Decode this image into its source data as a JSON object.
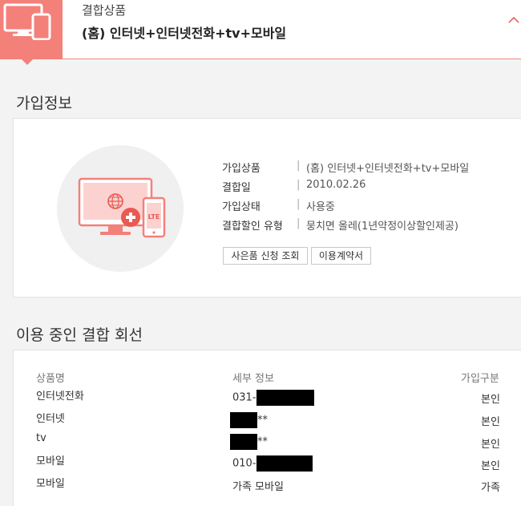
{
  "header": {
    "subtitle": "결합상품",
    "title": "(홈) 인터넷+인터넷전화+tv+모바일"
  },
  "signup_info": {
    "section_title": "가입정보",
    "rows": [
      {
        "label": "가입상품",
        "value": "(홈) 인터넷+인터넷전화+tv+모바일"
      },
      {
        "label": "결합일",
        "value": "2010.02.26"
      },
      {
        "label": "가입상태",
        "value": "사용중"
      },
      {
        "label": "결합할인 유형",
        "value": "뭉치면 올레(1년약정이상할인제공)"
      }
    ],
    "separator": "|",
    "icon_badge": "LTE",
    "buttons": {
      "gift_inquiry": "사은품 신청 조회",
      "contract": "이용계약서"
    }
  },
  "lines": {
    "section_title": "이용 중인 결합 회선",
    "columns": {
      "product": "상품명",
      "detail": "세부 정보",
      "type": "가입구분"
    },
    "rows": [
      {
        "product": "인터넷전화",
        "detail_prefix": "031-",
        "detail_suffix": "",
        "type": "본인"
      },
      {
        "product": "인터넷",
        "detail_prefix": "",
        "detail_suffix": "**",
        "type": "본인"
      },
      {
        "product": "tv",
        "detail_prefix": "",
        "detail_suffix": "**",
        "type": "본인"
      },
      {
        "product": "모바일",
        "detail_prefix": "010-",
        "detail_suffix": "",
        "type": "본인"
      },
      {
        "product": "모바일",
        "detail_prefix": "가족 모바일",
        "detail_suffix": "",
        "type": "가족"
      }
    ]
  },
  "colors": {
    "accent": "#f4807a",
    "background": "#f3f3f3"
  }
}
